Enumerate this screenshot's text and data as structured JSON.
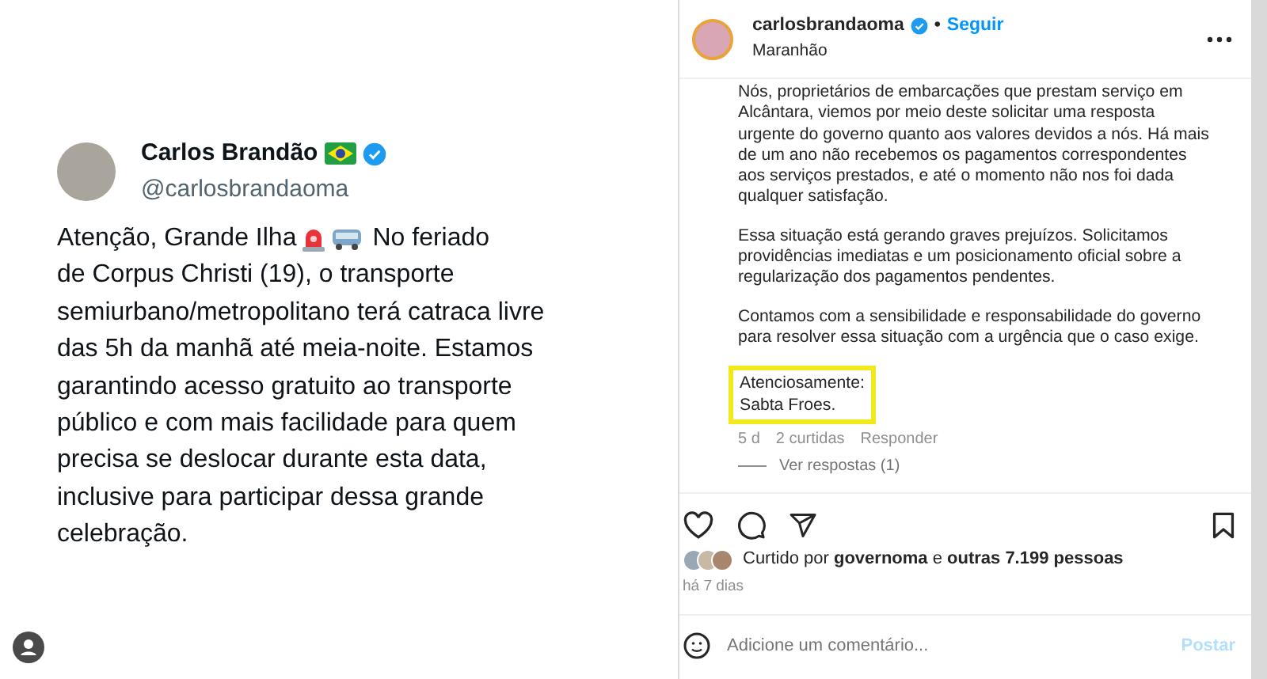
{
  "tweet": {
    "author_name": "Carlos Brandão",
    "handle": "@carlosbrandaoma",
    "verified": true,
    "text_start": "Atenção, Grande Ilha",
    "text_after_icons": "No feriado",
    "text_rest": "de Corpus Christi (19), o transporte semiurbano/metropolitano terá catraca livre das 5h da manhã até meia-noite. Estamos garantindo acesso gratuito ao transporte público e com mais facilidade para quem precisa se deslocar durante esta data, inclusive para participar dessa grande celebração."
  },
  "instagram": {
    "header": {
      "username": "carlosbrandaoma",
      "verified": true,
      "separator": "•",
      "follow": "Seguir",
      "location": "Maranhão"
    },
    "comment": {
      "paragraphs": [
        "Nós, proprietários de embarcações que prestam serviço em Alcântara, viemos por meio deste solicitar uma resposta urgente do governo quanto aos valores devidos a nós. Há mais de um ano não recebemos os pagamentos correspondentes aos serviços prestados, e até o momento não nos foi dada qualquer satisfação.",
        "Essa situação está gerando graves prejuízos. Solicitamos providências imediatas e um posicionamento oficial sobre a regularização dos pagamentos pendentes.",
        "Contamos com a sensibilidade e responsabilidade do governo para resolver essa situação com a urgência que o caso exige."
      ],
      "signature": [
        "Atenciosamente:",
        "Sabta Froes."
      ],
      "highlighted": true,
      "time": "5 d",
      "likes": "2 curtidas",
      "reply": "Responder",
      "view_replies": "Ver respostas (1)"
    },
    "likes_text": "Curtido por **governoma** e **outras 7.199 pessoas**",
    "date": "há 7 dias",
    "comment_input": {
      "placeholder": "Adicione um comentário..."
    },
    "post_button": "Postar"
  }
}
